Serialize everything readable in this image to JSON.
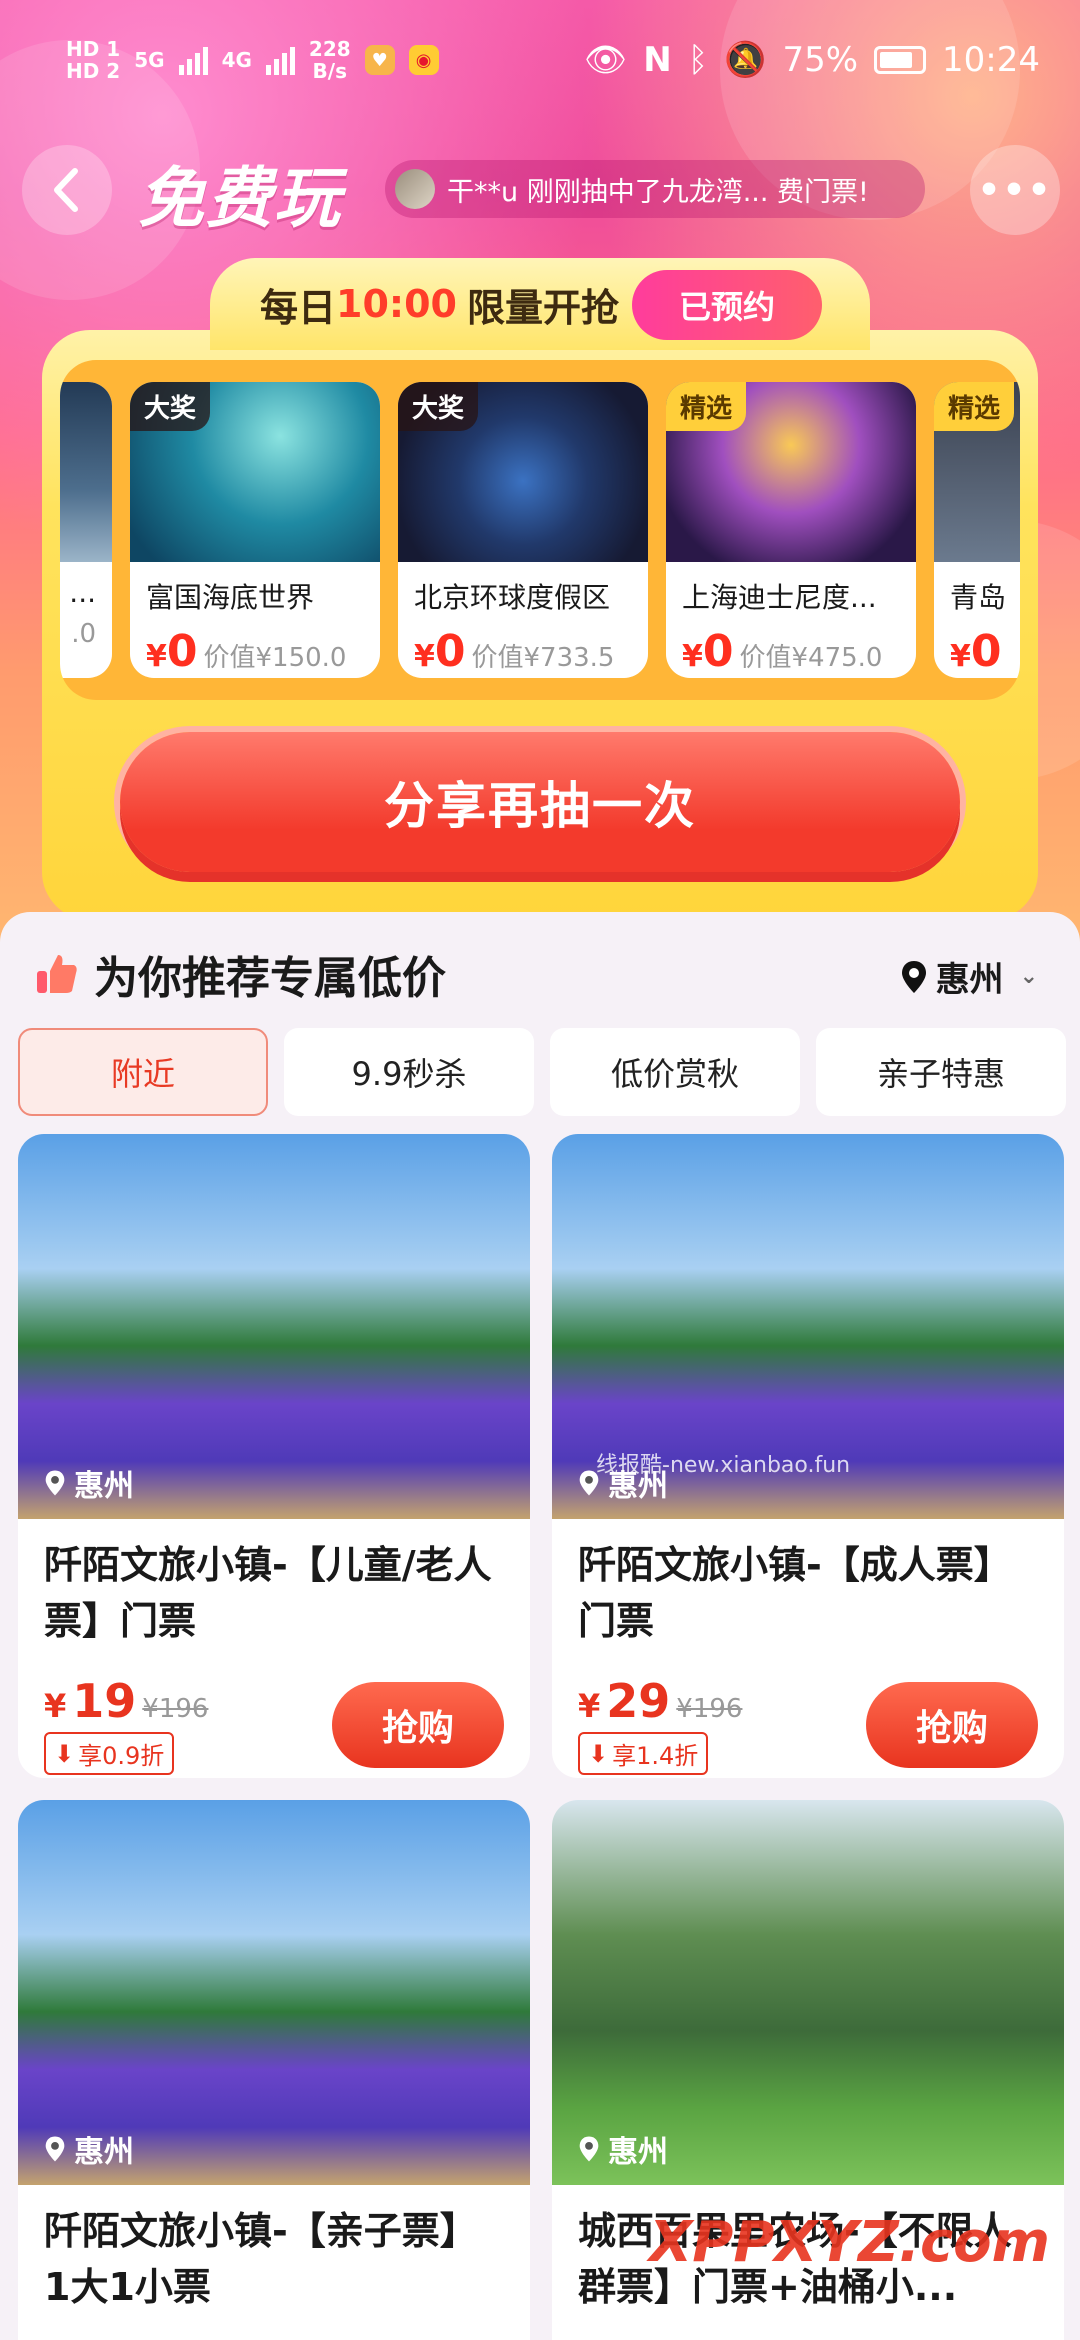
{
  "status_bar": {
    "hd1": "HD 1",
    "hd2": "HD 2",
    "sig1": "5G",
    "sig2": "4G",
    "net_speed_value": "228",
    "net_speed_unit": "B/s",
    "battery_pct": "75%",
    "time": "10:24"
  },
  "header": {
    "title": "免费玩",
    "ticker": "干**u 刚刚抽中了九龙湾... 费门票!",
    "more": "•••"
  },
  "lottery": {
    "daily_prefix": "每日",
    "daily_time": "10:00",
    "daily_suffix": "限量开抢",
    "reserved_button": "已预约",
    "share_button": "分享再抽一次",
    "prizes": [
      {
        "tag": "",
        "name": "...",
        "currency": "",
        "price": "",
        "worth": ".0"
      },
      {
        "tag": "大奖",
        "name": "富国海底世界",
        "currency": "¥",
        "price": "0",
        "worth": "价值¥150.0"
      },
      {
        "tag": "大奖",
        "name": "北京环球度假区",
        "currency": "¥",
        "price": "0",
        "worth": "价值¥733.5"
      },
      {
        "tag": "精选",
        "name": "上海迪士尼度...",
        "currency": "¥",
        "price": "0",
        "worth": "价值¥475.0"
      },
      {
        "tag": "精选",
        "name": "青岛",
        "currency": "¥",
        "price": "0",
        "worth": ""
      }
    ]
  },
  "recommend": {
    "title": "为你推荐专属低价",
    "city": "惠州",
    "filters": [
      "附近",
      "9.9秒杀",
      "低价赏秋",
      "亲子特惠"
    ],
    "products": [
      {
        "location": "惠州",
        "title": "阡陌文旅小镇-【儿童/老人票】门票",
        "yen": "¥",
        "price": "19",
        "orig": "¥196",
        "discount": "享0.9折",
        "buy": "抢购"
      },
      {
        "location": "惠州",
        "title": "阡陌文旅小镇-【成人票】门票",
        "yen": "¥",
        "price": "29",
        "orig": "¥196",
        "discount": "享1.4折",
        "buy": "抢购"
      },
      {
        "location": "惠州",
        "title": "阡陌文旅小镇-【亲子票】1大1小票",
        "yen": "",
        "price": "",
        "orig": "",
        "discount": "",
        "buy": ""
      },
      {
        "location": "惠州",
        "title": "城西百果里农场-【不限人群票】门票+油桶小...",
        "yen": "",
        "price": "",
        "orig": "",
        "discount": "",
        "buy": ""
      }
    ],
    "watermark_small": "线报酷-new.xianbao.fun",
    "watermark_big": "XPPXYZ.com"
  }
}
